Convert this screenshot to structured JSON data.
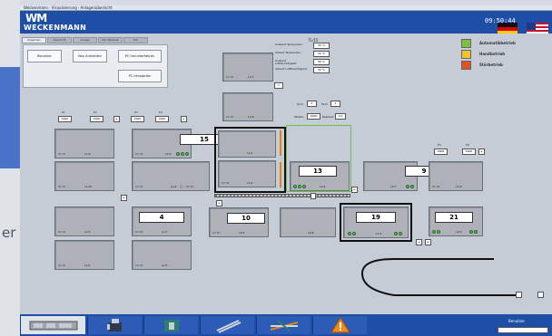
{
  "window": {
    "title_bar_text": "Weckenmann · Visualisierung · Anlagenübersicht"
  },
  "header": {
    "logo_mark": "WM",
    "logo_text": "WECKENMANN",
    "clock": "09:50:44",
    "flags": [
      "flag-germany-icon",
      "flag-usa-icon"
    ]
  },
  "outside": {
    "partial_text": "er"
  },
  "tabs": [
    "Allgemein",
    "Übersicht",
    "Anlage",
    "Handbetrieb",
    "Info"
  ],
  "buttons": {
    "benutzer": "Benutzer",
    "neu_anmelden": "Neu Anmelden",
    "pc_herunterfahren": "PC herunterfahren",
    "pc_neustarten": "PC neustarten"
  },
  "legend": [
    {
      "label": "Automatikbetrieb",
      "color": "#7cc142"
    },
    {
      "label": "Handbetrieb",
      "color": "#f2c12e"
    },
    {
      "label": "Störbetrieb",
      "color": "#e0521f"
    }
  ],
  "params": {
    "title": "TL/15",
    "rows": [
      {
        "label": "Sollwert Temperatur",
        "value": "30 °C"
      },
      {
        "label": "Istwert Temperatur",
        "value": "22 °C"
      },
      {
        "label": "Sollwert Luftfeuchtigkeit",
        "value": "80 %"
      },
      {
        "label": "Istwert Luftfeuchtigkeit",
        "value": "22 %"
      }
    ],
    "turm_label": "Turm",
    "turm_value": "2",
    "fach_label": "Fach",
    "fach_value": "2",
    "palette_label": "Palette",
    "palette_value": "0000",
    "restzeit_label": "Restzeit",
    "restzeit_value": "0.0"
  },
  "stations": {
    "s1": {
      "id": "L1/7"
    },
    "s2": {
      "id": "L1/8"
    },
    "s3": {
      "id": "L1/9"
    },
    "s4": {
      "id": "L1/10"
    },
    "s5": {
      "id": "L2/3"
    },
    "s6": {
      "id": "L2/1"
    },
    "s7": {
      "id": "L2/2"
    },
    "s8": {
      "id": "L1/4"
    },
    "s9": {
      "id": "L1/7"
    },
    "s10": {
      "id": "L1/5"
    },
    "s11": {
      "id": "L1/1"
    },
    "s12": {
      "id": "L1/2"
    },
    "s13": {
      "id": "L2/4"
    },
    "s14": {
      "id": "L2/5"
    },
    "s15": {
      "id": "L2/6"
    },
    "s16": {
      "id": "L1/3"
    },
    "s17": {
      "id": "L2/7"
    },
    "s18": {
      "id": "L2/8"
    },
    "s19": {
      "id": "L2/9"
    },
    "s20": {
      "id": "L2/6"
    },
    "s21": {
      "id": "L2/1"
    }
  },
  "numbers": {
    "n15": "15",
    "n13": "13",
    "n9": "9",
    "n4": "4",
    "n10": "10",
    "n19": "19",
    "n21": "21"
  },
  "pills": {
    "p1": "0000",
    "p2": "0000",
    "p3": "0000",
    "p4": "0000",
    "p5": "0000",
    "p6": "0000",
    "p_top": "0.0"
  },
  "footer": {
    "user_label": "Benutzer",
    "user_value": ""
  },
  "icons": {
    "b1": "machine-thumbnail-icon",
    "b2": "robot-icon",
    "b3": "station-icon",
    "b4": "rebar-icon",
    "b5": "mesh-icon",
    "b6": "warning-icon"
  }
}
